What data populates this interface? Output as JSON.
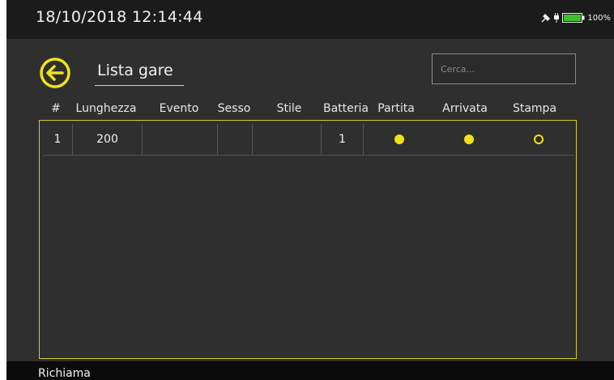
{
  "status": {
    "datetime": "18/10/2018 12:14:44",
    "battery_text": "100%",
    "icons": [
      "satellite-icon",
      "plug-icon",
      "battery-icon"
    ]
  },
  "header": {
    "title": "Lista gare",
    "back_icon": "back-arrow-circle-icon"
  },
  "search": {
    "placeholder": "Cerca...",
    "value": ""
  },
  "table": {
    "columns": [
      "#",
      "Lunghezza",
      "Evento",
      "Sesso",
      "Stile",
      "Batteria",
      "Partita",
      "Arrivata",
      "Stampa"
    ],
    "rows": [
      {
        "num": "1",
        "lunghezza": "200",
        "evento": "",
        "sesso": "",
        "stile": "",
        "batteria": "1",
        "partita": "filled",
        "arrivata": "filled",
        "stampa": "empty"
      }
    ]
  },
  "footer": {
    "recall_label": "Richiama"
  },
  "colors": {
    "accent": "#f0e21b",
    "background": "#2f2f2f",
    "statusbar": "#1b1b1b"
  }
}
